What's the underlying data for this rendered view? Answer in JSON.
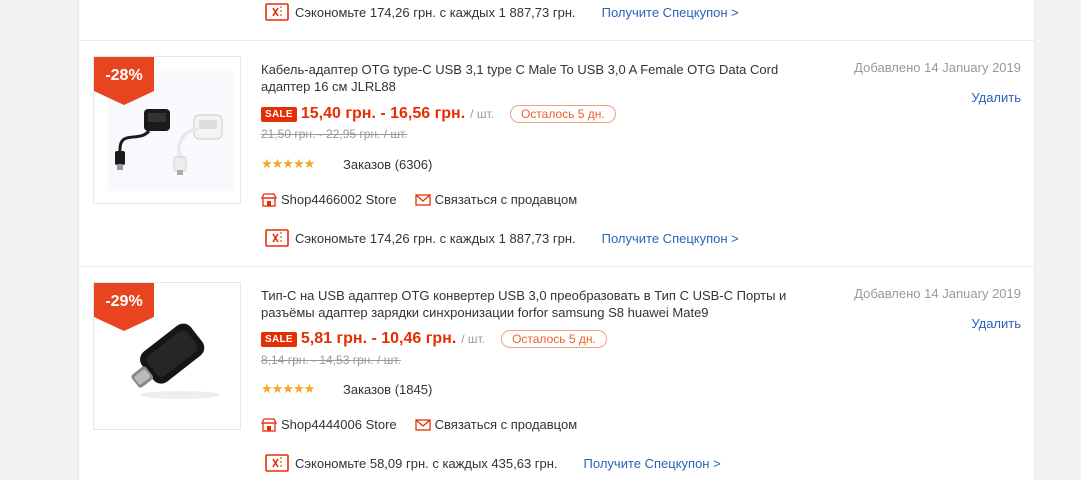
{
  "top_coupon": {
    "text": "Сэкономьте 174,26 грн. с каждых 1 887,73 грн.",
    "link": "Получите Спецкупон >"
  },
  "items": [
    {
      "discount": "-28%",
      "title": "Кабель-адаптер OTG type-C USB 3,1 type C Male To USB 3,0 A Female OTG Data Cord адаптер 16 см JLRL88",
      "added": "Добавлено 14 January 2019",
      "delete": "Удалить",
      "sale_label": "SALE",
      "price": "15,40 грн. - 16,56 грн.",
      "unit": "/ шт.",
      "remaining": "Осталось 5 дн.",
      "old_price": "21,50 грн. - 22,95 грн. / шт.",
      "stars": "★★★★★",
      "rating_value": 4.8,
      "orders": "Заказов (6306)",
      "store": "Shop4466002 Store",
      "contact": "Связаться с продавцом",
      "coupon_text": "Сэкономьте 174,26 грн. с каждых 1 887,73 грн.",
      "coupon_link": "Получите Спецкупон >"
    },
    {
      "discount": "-29%",
      "title": "Тип-C на USB адаптер OTG конвертер USB 3,0 преобразовать в Тип C USB-C Порты и разъёмы адаптер зарядки синхронизации forfor samsung S8 huawei Mate9",
      "added": "Добавлено 14 January 2019",
      "delete": "Удалить",
      "sale_label": "SALE",
      "price": "5,81 грн. - 10,46 грн.",
      "unit": "/ шт.",
      "remaining": "Осталось 5 дн.",
      "old_price": "8,14 грн. - 14,53 грн. / шт.",
      "stars": "★★★★★",
      "rating_value": 4.9,
      "orders": "Заказов (1845)",
      "store": "Shop4444006 Store",
      "contact": "Связаться с продавцом",
      "coupon_text": "Сэкономьте 58,09 грн. с каждых 435,63 грн.",
      "coupon_link": "Получите Спецкупон >"
    }
  ],
  "colors": {
    "accent_red": "#e62e04",
    "link_blue": "#2a63b8",
    "star": "#f5a623"
  }
}
